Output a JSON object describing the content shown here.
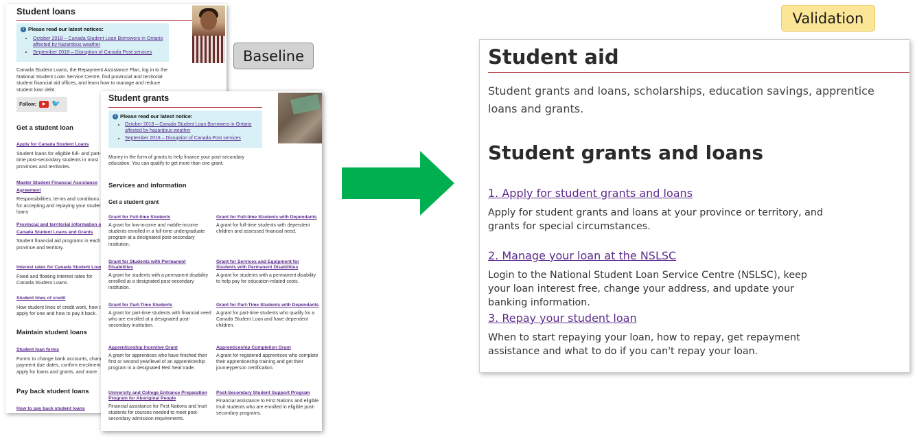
{
  "tags": {
    "baseline": "Baseline",
    "validation": "Validation"
  },
  "baseline_loans": {
    "title": "Student loans",
    "notice_heading": "Please read our latest notices:",
    "notices": [
      "October 2018 – Canada Student Loan Borrowers in Ontario affected by hazardous weather",
      "September 2018 – Disruption of Canada Post services"
    ],
    "intro": "Canada Student Loans, the Repayment Assistance Plan, log in to the National Student Loan Service Centre, find provincial and territorial student financial aid offices, and learn how to manage and reduce student loan debt.",
    "follow_label": "Follow:",
    "social_icons": [
      "youtube-icon",
      "twitter-icon"
    ],
    "sections": [
      {
        "heading": "Get a student loan"
      },
      {
        "heading": "Maintain student loans"
      },
      {
        "heading": "Pay back student loans"
      }
    ],
    "items": [
      {
        "link": "Apply for Canada Student Loans",
        "desc": "Student loans for eligible full- and part-time post-secondary students in most provinces and territories."
      },
      {
        "link": "Master Student Financial Assistance Agreement",
        "desc": "Responsibilities, terms and conditions for accepting and repaying your student loans"
      },
      {
        "link": "Provincial and territorial information on Canada Student Loans and Grants",
        "desc": "Student financial aid programs in each province and territory."
      },
      {
        "link": "Interest rates for Canada Student Loans",
        "desc": "Fixed and floating interest rates for Canada Student Loans."
      },
      {
        "link": "Student lines of credit",
        "desc": "How student lines of credit work, how to apply for one and how to pay it back."
      },
      {
        "link": "Student loan forms",
        "desc": "Forms to change bank accounts, change payment due dates, confirm enrolment, apply for loans and grants, and more."
      },
      {
        "link": "How to pay back student loans",
        "desc": ""
      }
    ]
  },
  "baseline_grants": {
    "title": "Student grants",
    "notice_heading": "Please read our latest notice:",
    "notices": [
      "October 2018 – Canada Student Loan Borrowers in Ontario affected by hazardous weather",
      "September 2018 – Disruption of Canada Post services"
    ],
    "intro": "Money in the form of grants to help finance your post-secondary education. You can qualify to get more than one grant.",
    "services_heading": "Services and information",
    "subheading": "Get a student grant",
    "grants": [
      {
        "link": "Grant for Full-time Students",
        "desc": "A grant for low-income and middle-income students enrolled in a full-time undergraduate program at a designated post-secondary institution."
      },
      {
        "link": "Grant for Full-time Students with Dependants",
        "desc": "A grant for full-time students with dependent children and assessed financial need."
      },
      {
        "link": "Grant for Students with Permanent Disabilities",
        "desc": "A grant for students with a permanent disability enrolled at a designated post-secondary institution."
      },
      {
        "link": "Grant for Services and Equipment for Students with Permanent Disabilities",
        "desc": "A grant for students with a permanent disability to help pay for education-related costs."
      },
      {
        "link": "Grant for Part-Time Students",
        "desc": "A grant for part-time students with financial need who are enrolled at a designated post-secondary institution."
      },
      {
        "link": "Grant for Part-Time Students with Dependants",
        "desc": "A grant for part-time students who qualify for a Canada Student Loan and have dependent children."
      },
      {
        "link": "Apprenticeship Incentive Grant",
        "desc": "A grant for apprentices who have finished their first or second year/level of an apprenticeship program in a designated Red Seal trade."
      },
      {
        "link": "Apprenticeship Completion Grant",
        "desc": "A grant for registered apprentices who complete their apprenticeship training and get their journeyperson certification."
      },
      {
        "link": "University and College Entrance Preparation Program for Aboriginal People",
        "desc": "Financial assistance for First Nations and Inuit students for courses needed to meet post-secondary admission requirements."
      },
      {
        "link": "Post-Secondary Student Support Program",
        "desc": "Financial assistance to First Nations and eligible Inuit students who are enrolled in eligible post-secondary programs."
      }
    ]
  },
  "validation": {
    "title": "Student aid",
    "lead": "Student grants and loans, scholarships, education savings, apprentice loans and grants.",
    "heading": "Student grants and loans",
    "items": [
      {
        "link": "1. Apply for student grants and loans",
        "desc": "Apply for student grants and loans at your province or territory, and grants for special circumstances."
      },
      {
        "link": "2. Manage your loan at the NSLSC",
        "desc": "Login to the National Student Loan Service Centre (NSLSC), keep your loan interest free, change your address, and update your banking information."
      },
      {
        "link": "3. Repay your student loan",
        "desc": "When to start repaying your loan, how to repay, get repayment assistance and what to do if you can't repay your loan."
      }
    ]
  },
  "colors": {
    "accent_rule": "#af3c43",
    "link": "#5b2a8c",
    "arrow": "#00b050",
    "notice_bg": "#d8f0f6",
    "validation_tag_bg": "#fbe596"
  }
}
